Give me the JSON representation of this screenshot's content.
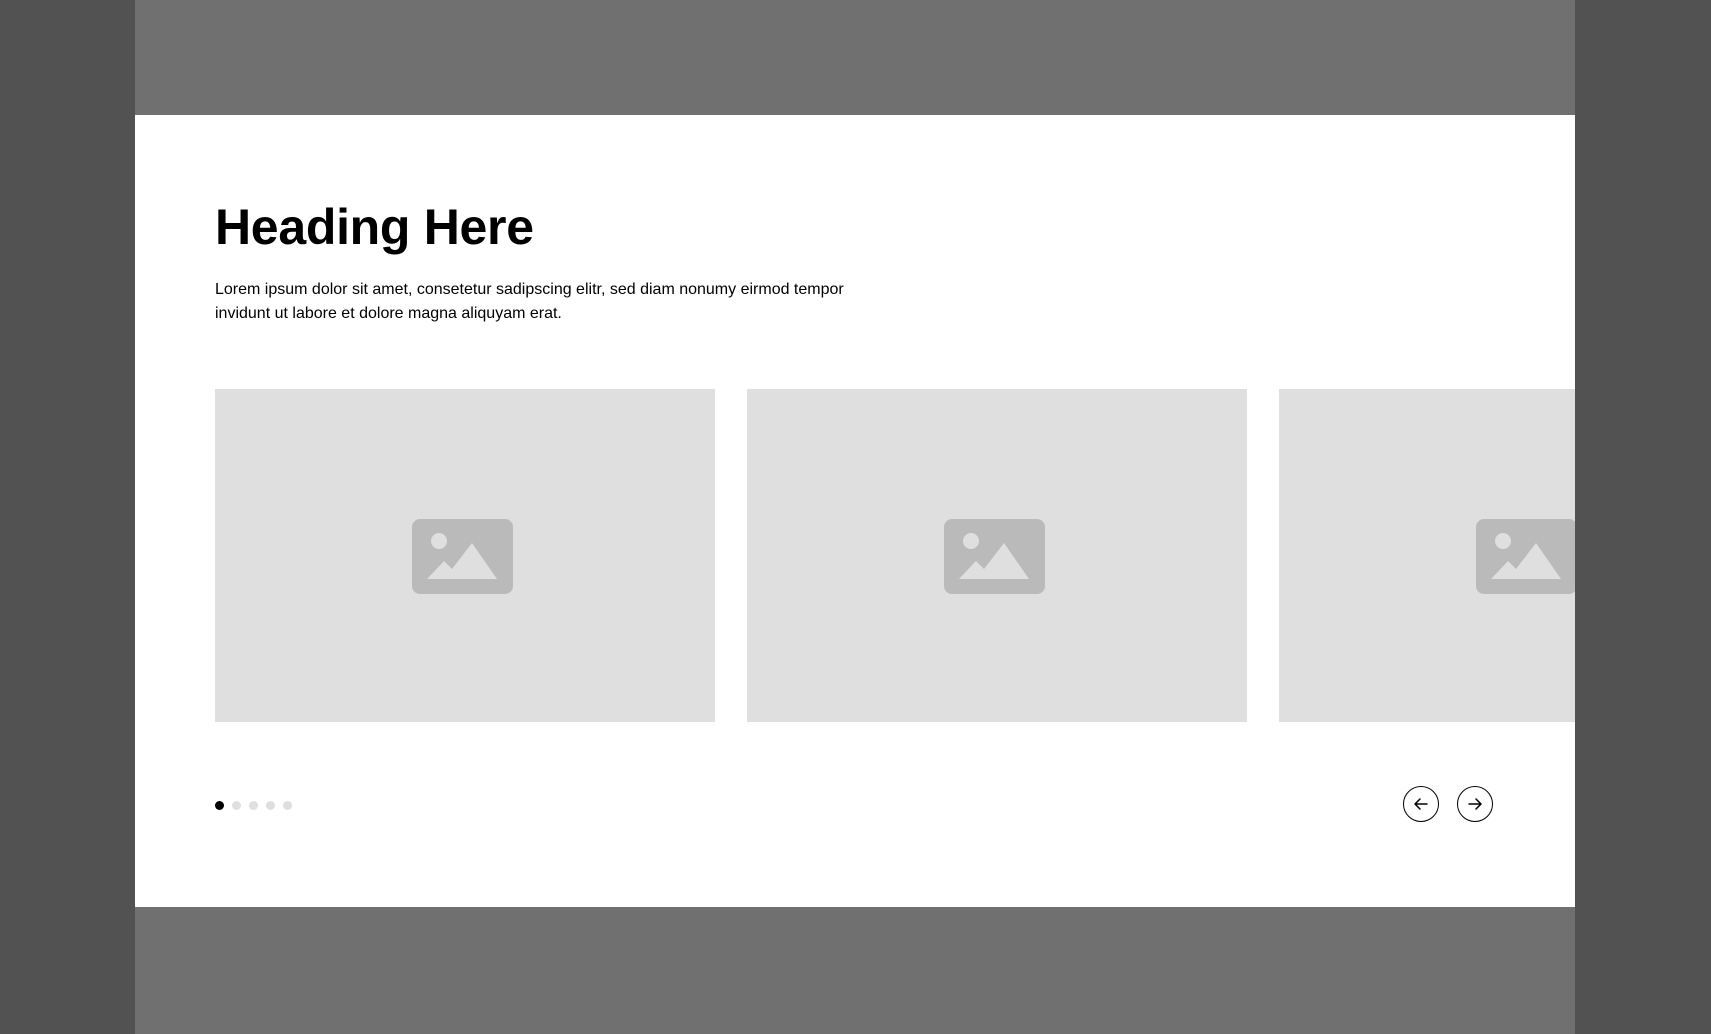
{
  "section": {
    "heading": "Heading Here",
    "description": "Lorem ipsum dolor sit amet, consetetur sadipscing elitr, sed diam nonumy eirmod tempor invidunt ut labore et dolore magna aliquyam erat."
  },
  "carousel": {
    "slides": [
      {
        "icon": "image-placeholder-icon"
      },
      {
        "icon": "image-placeholder-icon"
      },
      {
        "icon": "image-placeholder-icon"
      }
    ],
    "pagination": {
      "total": 5,
      "active": 1
    },
    "controls": {
      "prev_icon": "arrow-left-icon",
      "next_icon": "arrow-right-icon"
    }
  },
  "colors": {
    "outer_background": "#525252",
    "frame_background": "#707070",
    "section_background": "#ffffff",
    "placeholder_fill": "#dfdfdf",
    "placeholder_icon": "#bababa",
    "text": "#000000",
    "dot_active": "#000000",
    "dot_inactive": "#dfdfdf"
  }
}
